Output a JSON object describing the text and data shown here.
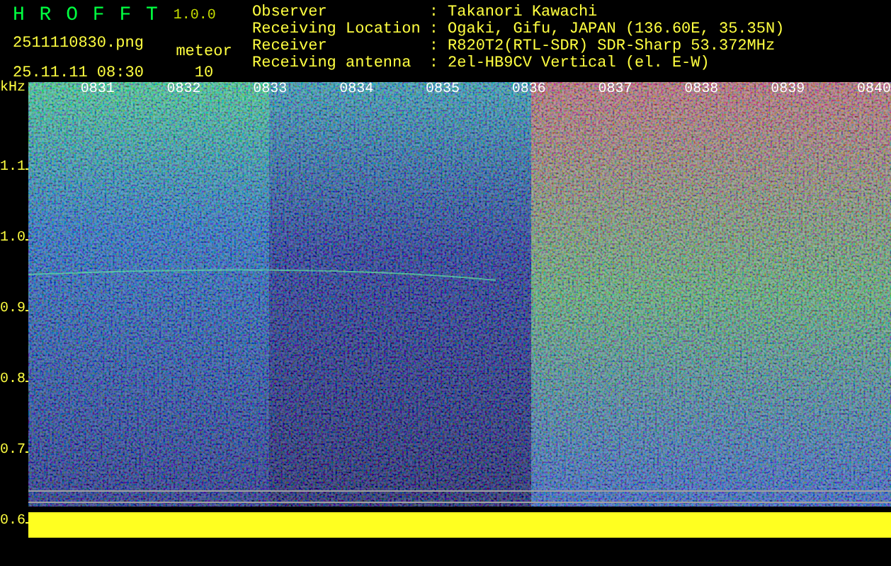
{
  "app": {
    "name": "H R O F F T",
    "version": "1.0.0"
  },
  "file": "2511110830.png",
  "datetime": "25.11.11 08:30",
  "counter": {
    "label": "meteor",
    "value": "10"
  },
  "info": [
    {
      "label": "Observer",
      "value": ": Takanori Kawachi"
    },
    {
      "label": "Receiving Location",
      "value": ": Ogaki, Gifu, JAPAN (136.60E, 35.35N)"
    },
    {
      "label": "Receiver",
      "value": ": R820T2(RTL-SDR) SDR-Sharp 53.372MHz"
    },
    {
      "label": "Receiving antenna",
      "value": ": 2el-HB9CV Vertical (el. E-W)"
    }
  ],
  "spectrogram": {
    "y_unit": "kHz",
    "y_labels": [
      "1.1",
      "1.0",
      "0.9",
      "0.8",
      "0.7",
      "0.6"
    ],
    "x_labels": [
      "0831",
      "0832",
      "0833",
      "0834",
      "0835",
      "0836",
      "0837",
      "0838",
      "0839",
      "0840"
    ]
  }
}
